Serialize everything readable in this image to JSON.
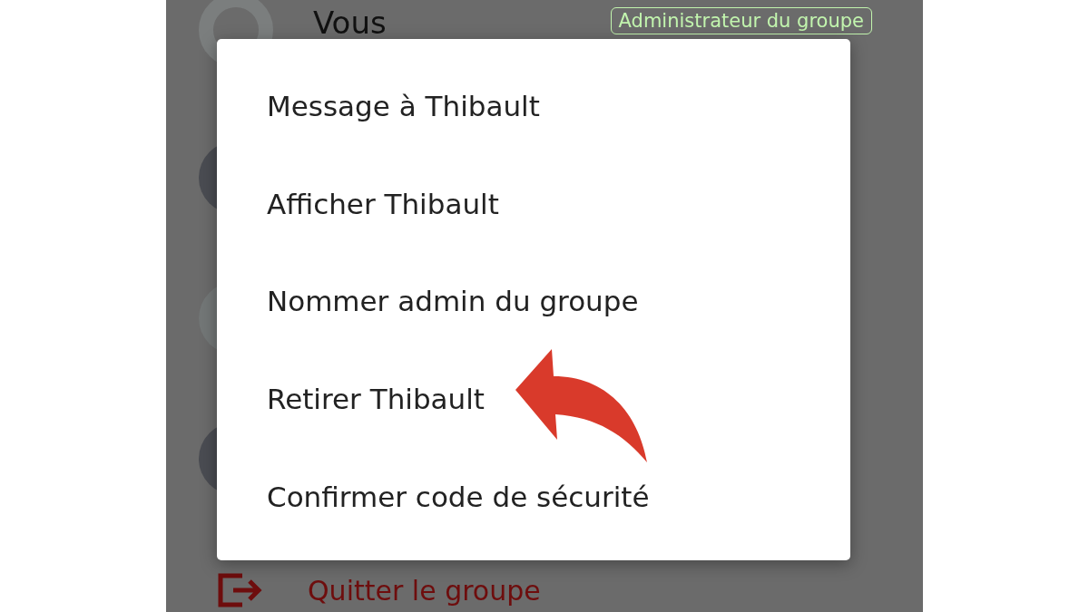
{
  "header_row": {
    "name": "Vous",
    "badge": "Administrateur du groupe"
  },
  "members": [
    {
      "kind": "photo"
    },
    {
      "kind": "plain"
    },
    {
      "kind": "photo"
    }
  ],
  "menu": {
    "items": [
      {
        "label": "Message à Thibault",
        "highlighted": false
      },
      {
        "label": "Afficher Thibault",
        "highlighted": false
      },
      {
        "label": "Nommer admin du groupe",
        "highlighted": false
      },
      {
        "label": "Retirer Thibault",
        "highlighted": true
      },
      {
        "label": "Confirmer code de sécurité",
        "highlighted": false
      }
    ]
  },
  "footer": {
    "label": "Quitter le groupe"
  }
}
